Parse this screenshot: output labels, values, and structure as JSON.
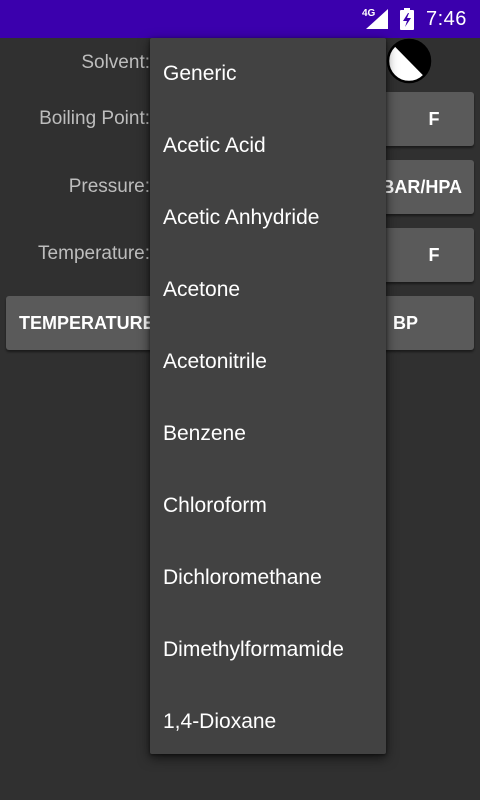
{
  "status_bar": {
    "network": "4G",
    "time": "7:46",
    "background_color": "#3b00ad",
    "icons": [
      "signal-icon",
      "battery-charging-icon"
    ]
  },
  "form": {
    "solvent_label": "Solvent:",
    "boiling_point_label": "Boiling Point:",
    "boiling_point_unit": "F",
    "pressure_label": "Pressure:",
    "pressure_unit": "BAR/HPA",
    "temperature_label": "Temperature:",
    "temperature_unit": "F",
    "calc_temperature_button": "TEMPERATURE",
    "calc_bp_button": "BP"
  },
  "theme_toggle": {
    "icon": "contrast-icon"
  },
  "solvent_dropdown": {
    "options": [
      "Generic",
      "Acetic Acid",
      "Acetic Anhydride",
      "Acetone",
      "Acetonitrile",
      "Benzene",
      "Chloroform",
      "Dichloromethane",
      "Dimethylformamide",
      "1,4-Dioxane"
    ],
    "background_color": "#424242"
  },
  "colors": {
    "app_background": "#303030",
    "button_background": "#5a5a5a",
    "label_text": "#bdbdbd"
  }
}
